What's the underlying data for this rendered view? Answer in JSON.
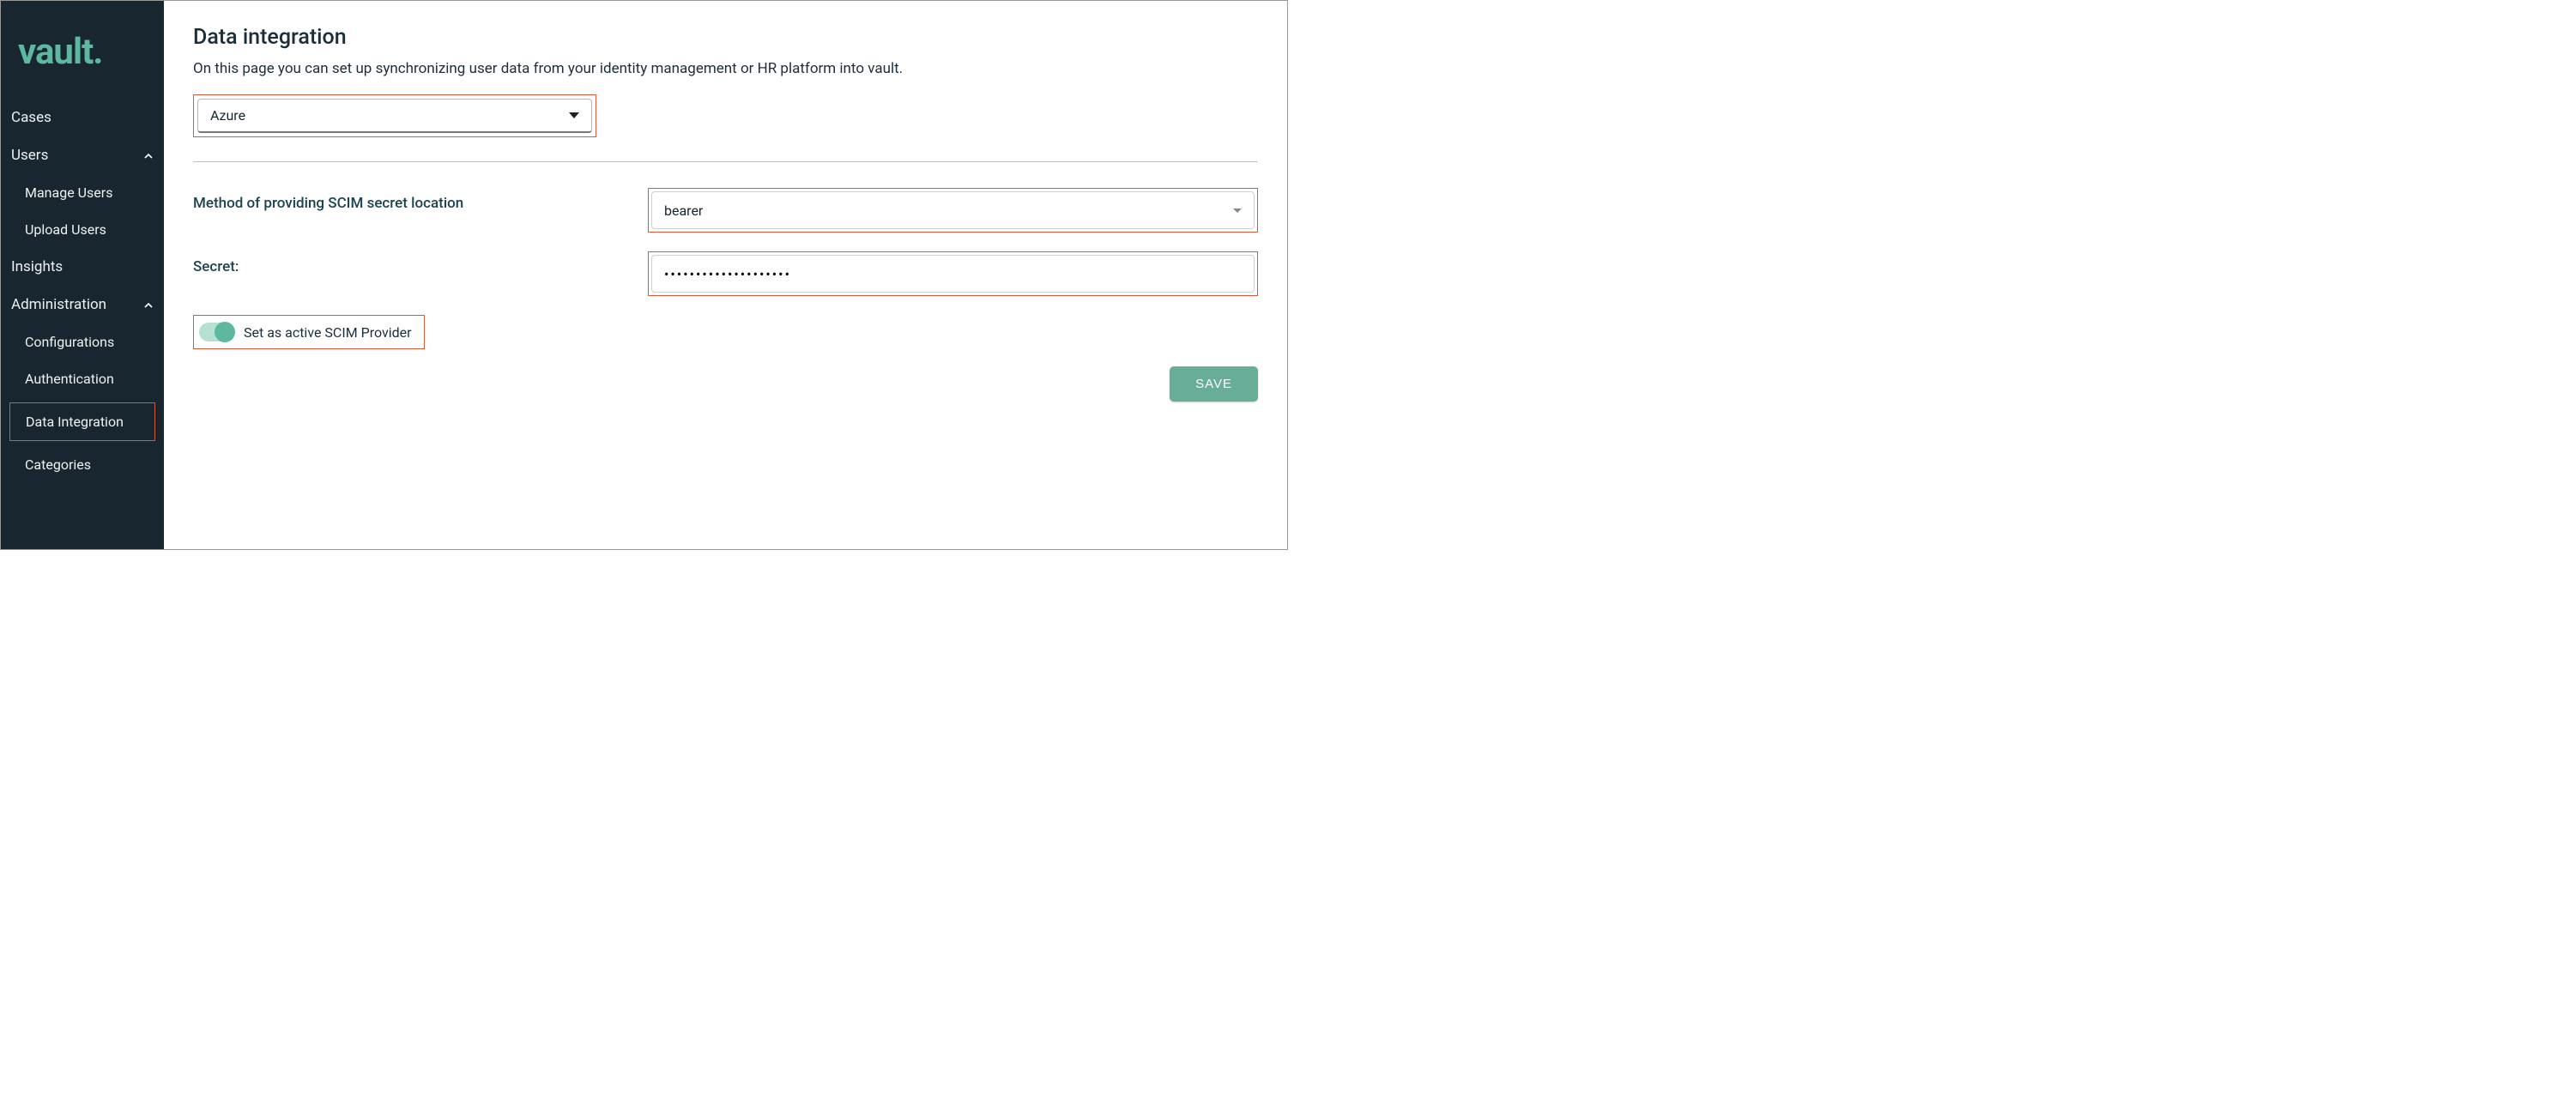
{
  "brand": "vault.",
  "sidebar": {
    "items": [
      {
        "label": "Cases",
        "expandable": false
      },
      {
        "label": "Users",
        "expandable": true,
        "expanded": true
      },
      {
        "label": "Manage Users"
      },
      {
        "label": "Upload Users"
      },
      {
        "label": "Insights",
        "expandable": false
      },
      {
        "label": "Administration",
        "expandable": true,
        "expanded": true
      },
      {
        "label": "Configurations"
      },
      {
        "label": "Authentication"
      },
      {
        "label": "Data Integration"
      },
      {
        "label": "Categories"
      }
    ]
  },
  "page": {
    "title": "Data integration",
    "description": "On this page you can set up synchronizing user data from your identity management or HR platform into vault.",
    "provider_select": "Azure",
    "scim_method_label": "Method of providing SCIM secret location",
    "scim_method_value": "bearer",
    "secret_label": "Secret:",
    "secret_value": "••••••••••••••••••••",
    "toggle_label": "Set as active SCIM Provider",
    "save_label": "SAVE"
  }
}
